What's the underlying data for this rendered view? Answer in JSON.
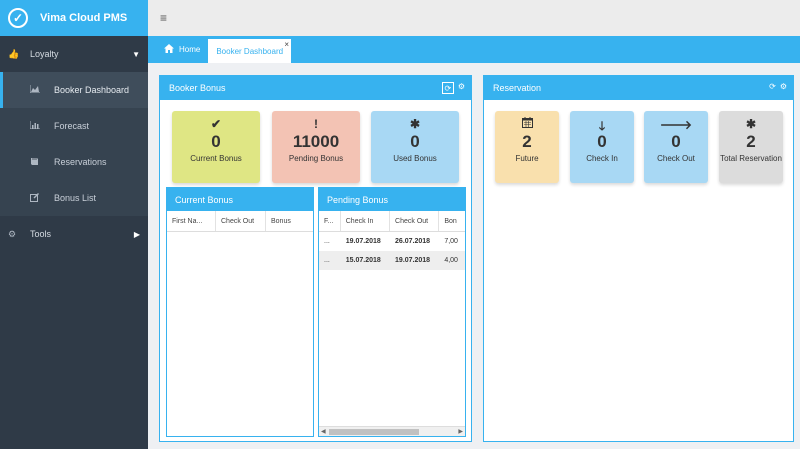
{
  "brand": {
    "title": "Vima Cloud PMS"
  },
  "sidebar": {
    "loyalty": {
      "label": "Loyalty"
    },
    "items": [
      {
        "label": "Booker Dashboard",
        "icon": "area-chart-icon"
      },
      {
        "label": "Forecast",
        "icon": "bar-chart-icon"
      },
      {
        "label": "Reservations",
        "icon": "book-icon"
      },
      {
        "label": "Bonus List",
        "icon": "edit-icon"
      }
    ],
    "tools": {
      "label": "Tools"
    }
  },
  "tabs": {
    "home": "Home",
    "active": "Booker Dashboard"
  },
  "booker_bonus": {
    "title": "Booker Bonus",
    "cards": [
      {
        "value": "0",
        "label": "Current Bonus",
        "color": "#dfe684"
      },
      {
        "value": "11000",
        "label": "Pending Bonus",
        "color": "#f3c3b4"
      },
      {
        "value": "0",
        "label": "Used Bonus",
        "color": "#a8d8f4"
      }
    ]
  },
  "current_bonus": {
    "title": "Current Bonus",
    "columns": [
      "First Na...",
      "Check Out",
      "Bonus"
    ]
  },
  "pending_bonus": {
    "title": "Pending Bonus",
    "columns": [
      "F...",
      "Check In",
      "Check Out",
      "Bon"
    ],
    "rows": [
      {
        "c0": "...",
        "c1": "19.07.2018",
        "c2": "26.07.2018",
        "c3": "7,00"
      },
      {
        "c0": "...",
        "c1": "15.07.2018",
        "c2": "19.07.2018",
        "c3": "4,00"
      }
    ]
  },
  "reservation": {
    "title": "Reservation",
    "cards": [
      {
        "value": "2",
        "label": "Future",
        "color": "#f9e0ad"
      },
      {
        "value": "0",
        "label": "Check In",
        "color": "#a8d8f4"
      },
      {
        "value": "0",
        "label": "Check Out",
        "color": "#a8d8f4"
      },
      {
        "value": "2",
        "label": "Total Reservation",
        "color": "#dcdcdc"
      }
    ]
  }
}
